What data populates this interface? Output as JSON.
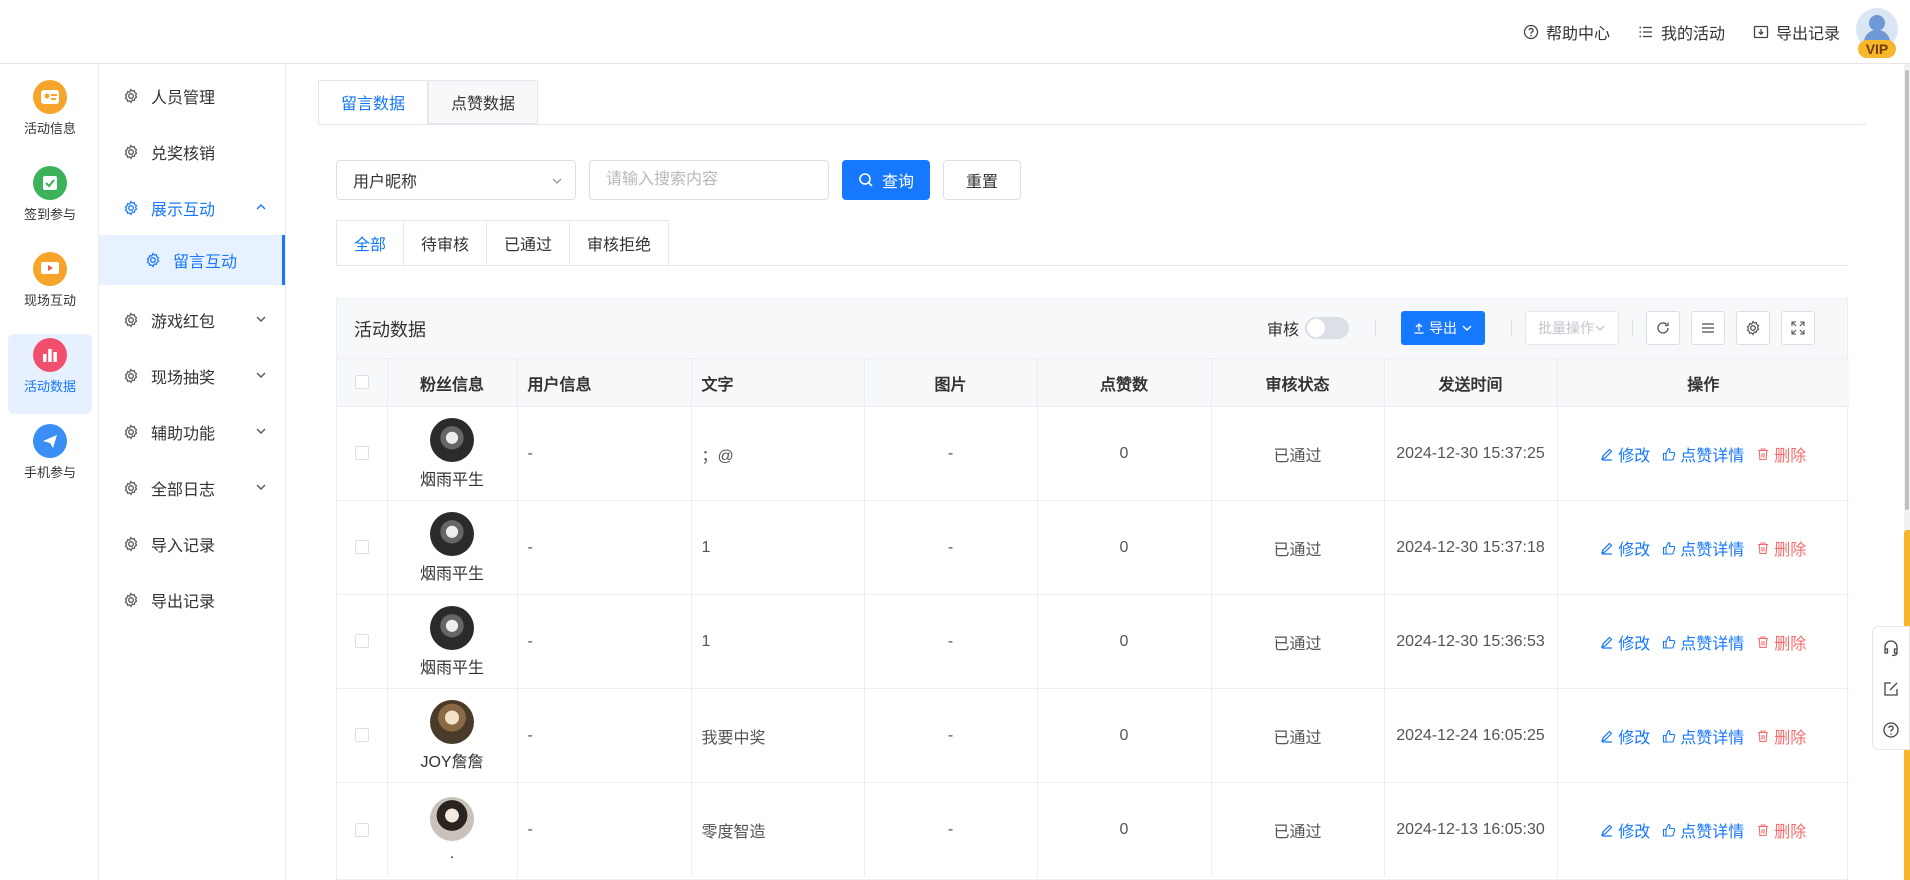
{
  "header": {
    "help": "帮助中心",
    "my_activities": "我的活动",
    "export_records": "导出记录",
    "vip": "VIP"
  },
  "rail": [
    {
      "label": "活动信息",
      "icon": "activity-info-icon",
      "color": "#f7a52a"
    },
    {
      "label": "签到参与",
      "icon": "checkin-icon",
      "color": "#3cb35a"
    },
    {
      "label": "现场互动",
      "icon": "live-interact-icon",
      "color": "#f7a52a"
    },
    {
      "label": "活动数据",
      "icon": "activity-data-icon",
      "color": "#f0506e",
      "active": true
    },
    {
      "label": "手机参与",
      "icon": "mobile-join-icon",
      "color": "#3a8ef6"
    }
  ],
  "submenu": {
    "people": "人员管理",
    "redeem": "兑奖核销",
    "display": "展示互动",
    "message": "留言互动",
    "game": "游戏红包",
    "lottery": "现场抽奖",
    "assist": "辅助功能",
    "logs": "全部日志",
    "imports": "导入记录",
    "exports": "导出记录"
  },
  "tabs_top": {
    "msg": "留言数据",
    "likes": "点赞数据"
  },
  "filter": {
    "select_value": "用户昵称",
    "search_placeholder": "请输入搜索内容",
    "query": "查询",
    "reset": "重置"
  },
  "status_tabs": {
    "all": "全部",
    "pending": "待审核",
    "passed": "已通过",
    "rejected": "审核拒绝"
  },
  "panel": {
    "title": "活动数据",
    "audit": "审核",
    "export": "导出",
    "batch": "批量操作"
  },
  "table": {
    "headers": {
      "fan": "粉丝信息",
      "user": "用户信息",
      "text": "文字",
      "image": "图片",
      "likes": "点赞数",
      "status": "审核状态",
      "time": "发送时间",
      "ops": "操作"
    },
    "ops": {
      "edit": "修改",
      "detail": "点赞详情",
      "delete": "删除"
    },
    "rows": [
      {
        "fan": "烟雨平生",
        "user": "-",
        "text": "；@",
        "image": "-",
        "likes": "0",
        "status": "已通过",
        "time": "2024-12-30 15:37:25"
      },
      {
        "fan": "烟雨平生",
        "user": "-",
        "text": "1",
        "image": "-",
        "likes": "0",
        "status": "已通过",
        "time": "2024-12-30 15:37:18"
      },
      {
        "fan": "烟雨平生",
        "user": "-",
        "text": "1",
        "image": "-",
        "likes": "0",
        "status": "已通过",
        "time": "2024-12-30 15:36:53"
      },
      {
        "fan": "JOY詹詹",
        "user": "-",
        "text": "我要中奖",
        "image": "-",
        "likes": "0",
        "status": "已通过",
        "time": "2024-12-24 16:05:25"
      },
      {
        "fan": ".",
        "user": "-",
        "text": "零度智造",
        "image": "-",
        "likes": "0",
        "status": "已通过",
        "time": "2024-12-13 16:05:30"
      }
    ]
  }
}
